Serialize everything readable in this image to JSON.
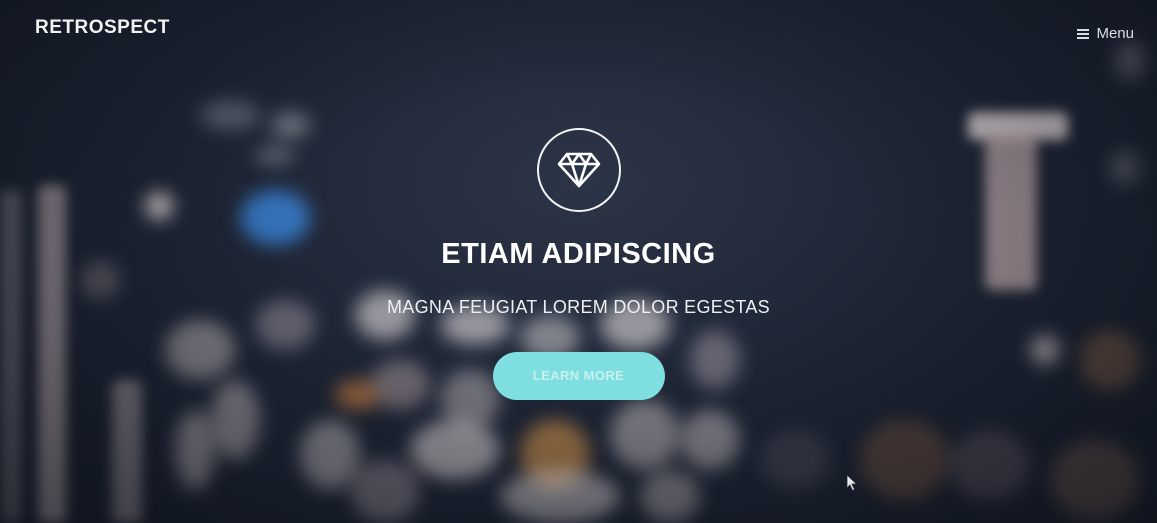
{
  "header": {
    "logo": "RETROSPECT",
    "menu_label": "Menu",
    "menu_icon": "hamburger-icon"
  },
  "hero": {
    "icon": "diamond-icon",
    "title": "ETIAM ADIPISCING",
    "subtitle": "MAGNA FEUGIAT LOREM DOLOR EGESTAS",
    "cta_label": "LEARN MORE"
  },
  "colors": {
    "background": "#1e2535",
    "accent": "#7fdfe0",
    "text": "#ffffff"
  }
}
